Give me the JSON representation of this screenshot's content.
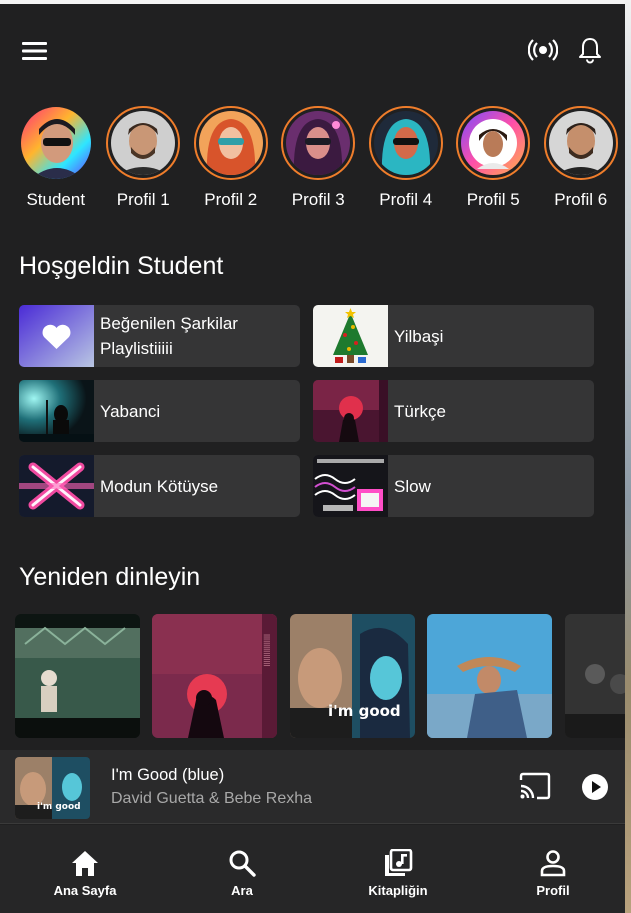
{
  "header": {
    "menu_icon": "hamburger-menu-icon",
    "cast_icon": "broadcast-icon",
    "bell_icon": "notification-bell-icon"
  },
  "profiles": [
    {
      "label": "Student"
    },
    {
      "label": "Profil 1"
    },
    {
      "label": "Profil 2"
    },
    {
      "label": "Profil 3"
    },
    {
      "label": "Profil 4"
    },
    {
      "label": "Profil 5"
    },
    {
      "label": "Profil 6"
    }
  ],
  "greeting": "Hoşgeldin Student",
  "quick_tiles": [
    {
      "label": "Beğenilen Şarkilar Playlistiiiii"
    },
    {
      "label": "Yilbaşi"
    },
    {
      "label": "Yabanci"
    },
    {
      "label": "Türkçe"
    },
    {
      "label": "Modun Kötüyse"
    },
    {
      "label": "Slow"
    }
  ],
  "recents_title": "Yeniden dinleyin",
  "mini_player": {
    "title": "I'm Good (blue)",
    "artist": "David Guetta & Bebe Rexha",
    "cover_text": "i'm good"
  },
  "nav": [
    {
      "label": "Ana Sayfa",
      "icon": "home-icon"
    },
    {
      "label": "Ara",
      "icon": "search-icon"
    },
    {
      "label": "Kitapliğin",
      "icon": "library-icon"
    },
    {
      "label": "Profil",
      "icon": "profile-icon"
    }
  ],
  "colors": {
    "background": "#202021",
    "tile": "#353536",
    "accent_ring": "#ef7d2b",
    "muted_text": "#a8a8a8"
  }
}
